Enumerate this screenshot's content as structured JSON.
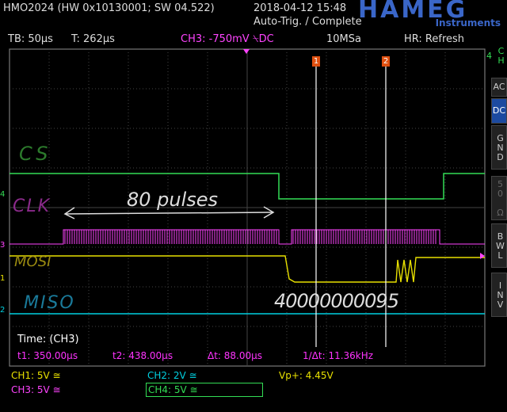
{
  "header": {
    "device": "HMO2024 (HW 0x10130001; SW 04.522)",
    "datetime": "2018-04-12 15:48",
    "status": "Auto-Trig. / Complete",
    "brand": "HAMEG",
    "brand_sub": "Instruments"
  },
  "toolbar": {
    "tb": "TB: 50µs",
    "t": "T: 262µs",
    "ch3": "CH3: -750mV ⍀DC",
    "sample_rate": "10MSa",
    "hr": "HR: Refresh"
  },
  "side_menu": {
    "ch": "CH 4",
    "ac": "AC",
    "dc": "DC",
    "gnd": "GND",
    "ohm": "50 Ω",
    "bwl": "BWL",
    "inv": "INV"
  },
  "annotations": {
    "cs": "CS",
    "clk": "CLK",
    "mosi": "MOSI",
    "miso": "MISO",
    "pulses": "80 pulses",
    "hex": "40000000095"
  },
  "cursors": {
    "c1": "1",
    "c2": "2"
  },
  "markers": {
    "m4": "4",
    "m3": "3",
    "m1": "1",
    "m2": "2"
  },
  "measurements": {
    "title": "Time: (CH3)",
    "t1": "t1: 350.00µs",
    "t2": "t2: 438.00µs",
    "dt": "Δt: 88.00µs",
    "freq": "1/Δt: 11.36kHz"
  },
  "footer": {
    "ch1": "CH1: 5V ≅",
    "ch2": "CH2: 2V ≅",
    "ch3": "CH3: 5V ≅",
    "ch4": "CH4: 5V ≅",
    "vp": "Vp+: 4.45V"
  },
  "colors": {
    "ch1": "#e8e000",
    "ch2": "#00d0e0",
    "ch3": "#ff44ff",
    "ch4": "#33dd55",
    "dc_active": "#1c4aa0"
  }
}
